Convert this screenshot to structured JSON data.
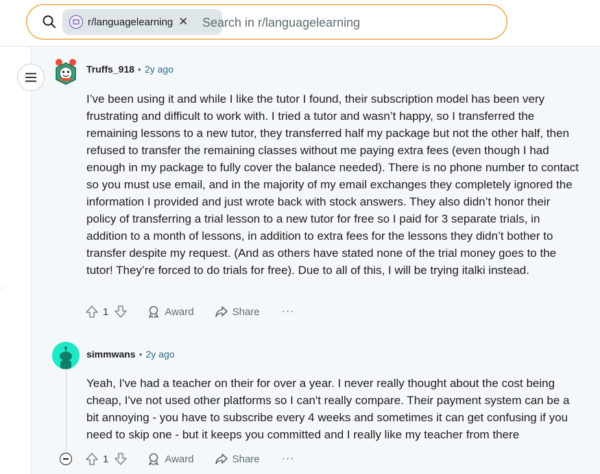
{
  "search": {
    "community_chip": "r/languagelearning",
    "placeholder": "Search in r/languagelearning",
    "chip_close": "✕"
  },
  "comments": [
    {
      "username": "Truffs_918",
      "age": "2y ago",
      "body": "I’ve been using it and while I like the tutor I found, their subscription model has been very frustrating and difficult to work with. I tried a tutor and wasn’t happy, so I transferred the remaining lessons to a new tutor, they transferred half my package but not the other half, then refused to transfer the remaining classes without me paying extra fees (even though I had enough in my package to fully cover the balance needed). There is no phone number to contact so you must use email, and in the majority of my email exchanges they completely ignored the information I provided and just wrote back with stock answers. They also didn’t honor their policy of transferring a trial lesson to a new tutor for free so I paid for 3 separate trials, in addition to a month of lessons, in addition to extra fees for the lessons they didn’t bother to transfer despite my request. (And as others have stated none of the trial money goes to the tutor! They’re forced to do trials for free). Due to all of this, I will be trying italki instead.",
      "votes": "1",
      "award_label": "Award",
      "share_label": "Share",
      "more_label": "···"
    },
    {
      "username": "simmwans",
      "age": "2y ago",
      "body": "Yeah, I've had a teacher on their for over a year. I never really thought about the cost being cheap, I've not used other platforms so I can't really compare. Their payment system can be a bit annoying - you have to subscribe every 4 weeks and sometimes it can get confusing if you need to skip one - but it keeps you committed and I really like my teacher from there",
      "votes": "1",
      "award_label": "Award",
      "share_label": "Share",
      "more_label": "···"
    }
  ],
  "separator": "•",
  "colors": {
    "accent_border": "#e8a33a",
    "chip_bg": "#dfe6ea",
    "age_text": "#2d6a8a",
    "avatar_teal": "#1ee8c5",
    "content_bg": "#f5f8fa"
  },
  "icons": [
    "search-icon",
    "subreddit-avatar-icon",
    "menu-icon",
    "upvote-icon",
    "downvote-icon",
    "award-icon",
    "share-icon",
    "more-icon",
    "collapse-icon"
  ]
}
